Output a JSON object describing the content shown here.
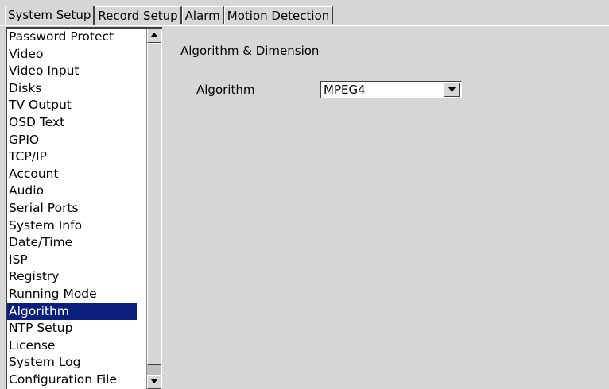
{
  "tabs": [
    {
      "label": "System Setup",
      "active": true
    },
    {
      "label": "Record Setup",
      "active": false
    },
    {
      "label": "Alarm",
      "active": false
    },
    {
      "label": "Motion Detection",
      "active": false
    }
  ],
  "sidebar": {
    "selected_index": 16,
    "items": [
      {
        "label": "Password Protect"
      },
      {
        "label": "Video"
      },
      {
        "label": "Video Input"
      },
      {
        "label": "Disks"
      },
      {
        "label": "TV Output"
      },
      {
        "label": "OSD Text"
      },
      {
        "label": "GPIO"
      },
      {
        "label": "TCP/IP"
      },
      {
        "label": "Account"
      },
      {
        "label": "Audio"
      },
      {
        "label": "Serial Ports"
      },
      {
        "label": "System Info"
      },
      {
        "label": "Date/Time"
      },
      {
        "label": "ISP"
      },
      {
        "label": "Registry"
      },
      {
        "label": "Running Mode"
      },
      {
        "label": "Algorithm"
      },
      {
        "label": "NTP Setup"
      },
      {
        "label": "License"
      },
      {
        "label": "System Log"
      },
      {
        "label": "Configuration File"
      }
    ],
    "scrollbar": {
      "up_icon": "arrow-up-icon",
      "down_icon": "arrow-down-icon"
    }
  },
  "panel": {
    "section_title": "Algorithm & Dimension",
    "algorithm_label": "Algorithm",
    "algorithm_value": "MPEG4",
    "dropdown_icon": "chevron-down-icon"
  },
  "colors": {
    "background": "#d6d6d6",
    "selection": "#0a1e7e",
    "list_background": "#ffffff"
  }
}
